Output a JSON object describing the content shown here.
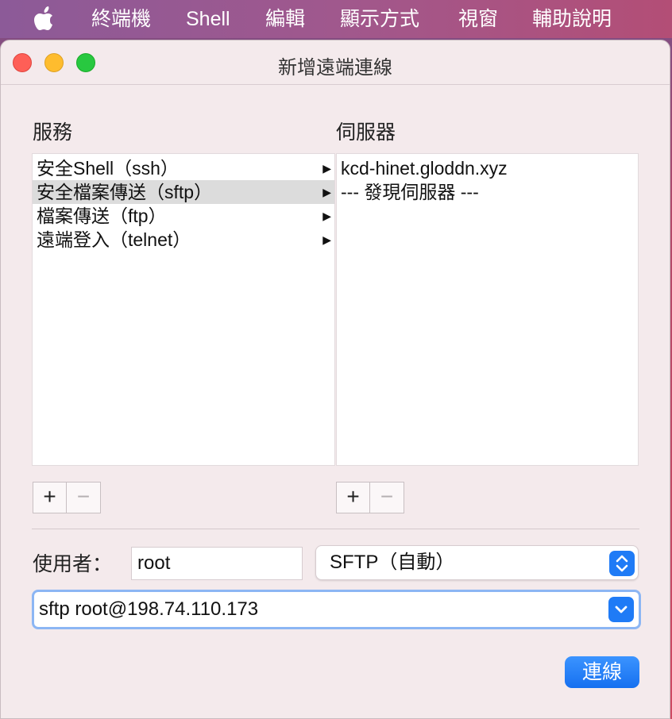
{
  "menubar": {
    "apple_icon": "apple-icon",
    "items": [
      "終端機",
      "Shell",
      "編輯",
      "顯示方式",
      "視窗",
      "輔助說明"
    ]
  },
  "window": {
    "title": "新增遠端連線",
    "controls": [
      "close",
      "minimize",
      "zoom"
    ]
  },
  "services": {
    "label": "服務",
    "items": [
      {
        "label": "安全Shell（ssh）",
        "selected": false
      },
      {
        "label": "安全檔案傳送（sftp）",
        "selected": true
      },
      {
        "label": "檔案傳送（ftp）",
        "selected": false
      },
      {
        "label": "遠端登入（telnet）",
        "selected": false
      }
    ],
    "add_label": "+",
    "remove_label": "−"
  },
  "servers": {
    "label": "伺服器",
    "items": [
      "kcd-hinet.gloddn.xyz",
      "--- 發現伺服器 ---"
    ],
    "add_label": "+",
    "remove_label": "−"
  },
  "user": {
    "label": "使用者：",
    "value": "root"
  },
  "protocol_popup": {
    "value": "SFTP（自動）"
  },
  "command": {
    "value": "sftp root@198.74.110.173"
  },
  "connect_button": {
    "label": "連線"
  },
  "colors": {
    "accent": "#1f7bf6",
    "window_bg": "#f4eaec",
    "close": "#fe5f57",
    "minimize": "#febc2e",
    "zoom": "#28c840"
  }
}
